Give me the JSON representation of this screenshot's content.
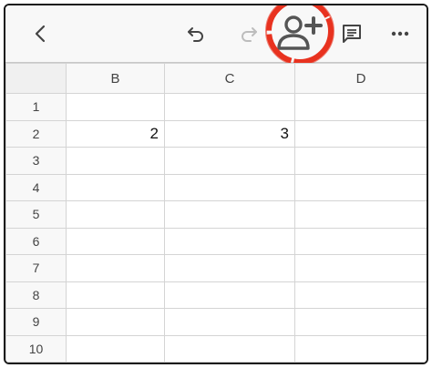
{
  "toolbar": {
    "back_icon": "chevron-left-icon",
    "undo_icon": "undo-icon",
    "redo_icon": "redo-icon",
    "share_icon": "add-person-icon",
    "comment_icon": "comment-icon",
    "more_icon": "more-horizontal-icon",
    "highlight_color": "#e8321f"
  },
  "sheet": {
    "columns": [
      "B",
      "C",
      "D"
    ],
    "rows": [
      {
        "label": "1",
        "cells": [
          "",
          "",
          ""
        ]
      },
      {
        "label": "2",
        "cells": [
          "2",
          "3",
          ""
        ]
      },
      {
        "label": "3",
        "cells": [
          "",
          "",
          ""
        ]
      },
      {
        "label": "4",
        "cells": [
          "",
          "",
          ""
        ]
      },
      {
        "label": "5",
        "cells": [
          "",
          "",
          ""
        ]
      },
      {
        "label": "6",
        "cells": [
          "",
          "",
          ""
        ]
      },
      {
        "label": "7",
        "cells": [
          "",
          "",
          ""
        ]
      },
      {
        "label": "8",
        "cells": [
          "",
          "",
          ""
        ]
      },
      {
        "label": "9",
        "cells": [
          "",
          "",
          ""
        ]
      },
      {
        "label": "10",
        "cells": [
          "",
          "",
          ""
        ]
      }
    ]
  }
}
